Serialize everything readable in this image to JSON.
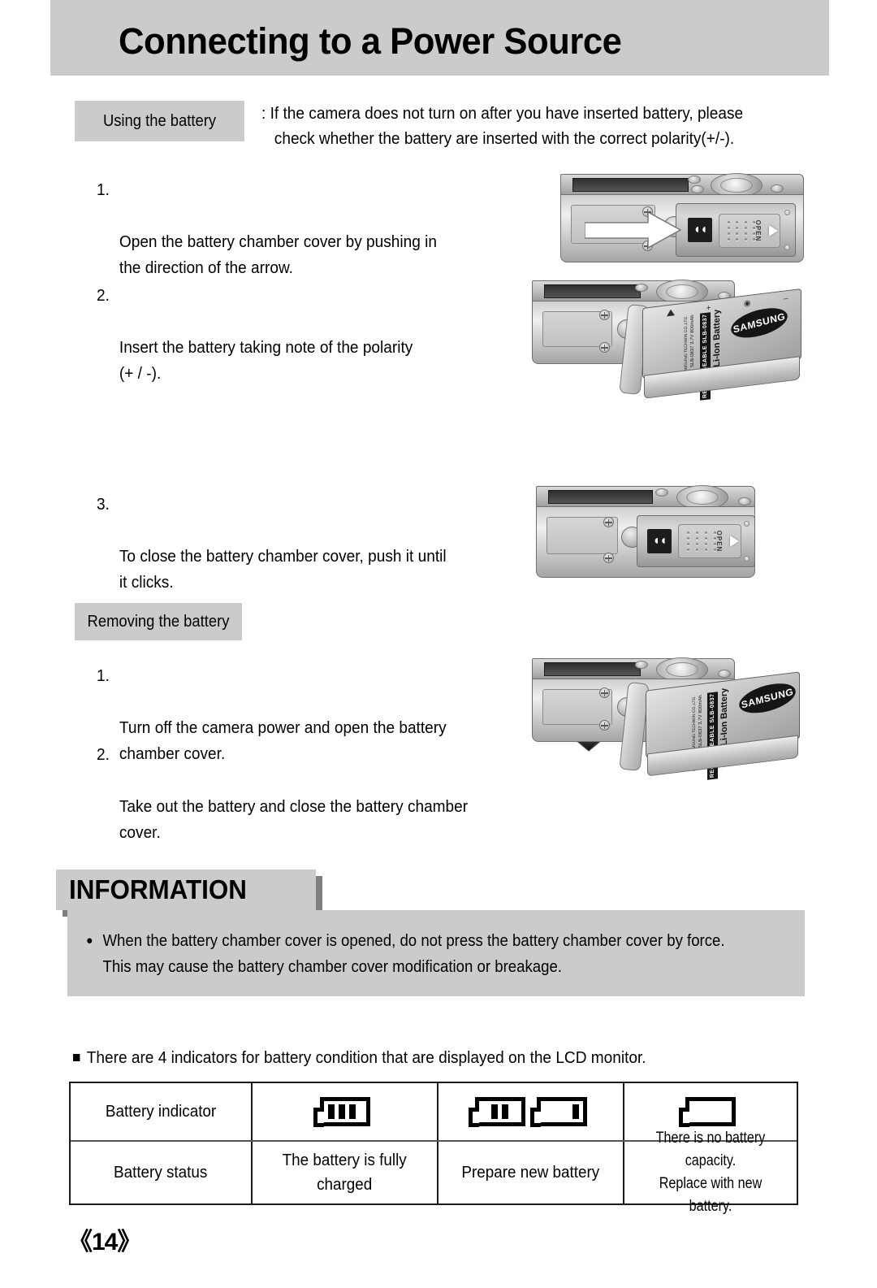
{
  "header": {
    "title": "Connecting to a Power Source"
  },
  "sections": {
    "using_battery_label": "Using the battery",
    "removing_battery_label": "Removing the battery"
  },
  "note": {
    "line1": ": If the camera does not turn on after you have inserted battery, please",
    "line2": "check whether the battery are inserted with the correct polarity(+/-)."
  },
  "using_steps": [
    {
      "num": "1.",
      "text": "Open the battery chamber cover by pushing in\nthe direction of the arrow."
    },
    {
      "num": "2.",
      "text": "Insert the battery taking note of the polarity\n(+ / -)."
    },
    {
      "num": "3.",
      "text": "To close the battery chamber cover, push it until\nit clicks."
    }
  ],
  "removing_steps": [
    {
      "num": "1.",
      "text": "Turn off the camera power and open the battery\nchamber cover."
    },
    {
      "num": "2.",
      "text": "Take out the battery and close the battery chamber\ncover."
    }
  ],
  "information": {
    "title": "INFORMATION",
    "bullet": "●",
    "body": "When the battery chamber cover is opened, do not press the battery chamber cover by\nforce. This may cause the battery chamber cover modification or breakage."
  },
  "indicator_lead": "There are 4 indicators for battery condition that are displayed on the LCD monitor.",
  "battery_table": {
    "rows": [
      {
        "label": "Battery indicator",
        "cells": [
          {
            "icons": [
              {
                "bars": 3,
                "align": "left"
              }
            ]
          },
          {
            "icons": [
              {
                "bars": 2,
                "align": "center"
              },
              {
                "bars": 1,
                "align": "right"
              }
            ]
          },
          {
            "icons": [
              {
                "bars": 0,
                "align": "left"
              }
            ]
          }
        ]
      },
      {
        "label": "Battery status",
        "cells": [
          {
            "text": "The battery is fully\ncharged"
          },
          {
            "text": "Prepare new battery"
          },
          {
            "text": "There is no battery capacity.\nReplace with new battery."
          }
        ]
      }
    ]
  },
  "figures": {
    "fig1_caption": "camera bottom with battery cover and open arrow",
    "fig2_caption": "battery being inserted into camera",
    "fig3_caption": "camera bottom with cover closed and push arrow",
    "fig4_caption": "battery being removed from camera",
    "cover_open_label": "OPEN",
    "cover_dc_label": "◖◖",
    "battery_brand": "SAMSUNG",
    "battery_type": "Li-Ion Battery",
    "battery_rechargeable": "RECHARGEABLE  SLB-0837",
    "battery_spec": "SLB-0837    3.7V  800mAh",
    "battery_maker": "Made by SAMSUNG TECHWIN CO.,LTD.",
    "battery_poles": [
      "+",
      "–"
    ]
  },
  "page_number": "《14》",
  "colors": {
    "band_gray": "#cbcbcb",
    "shadow_gray": "#808080",
    "table_border": "#1a1a1a",
    "text": "#000000"
  }
}
